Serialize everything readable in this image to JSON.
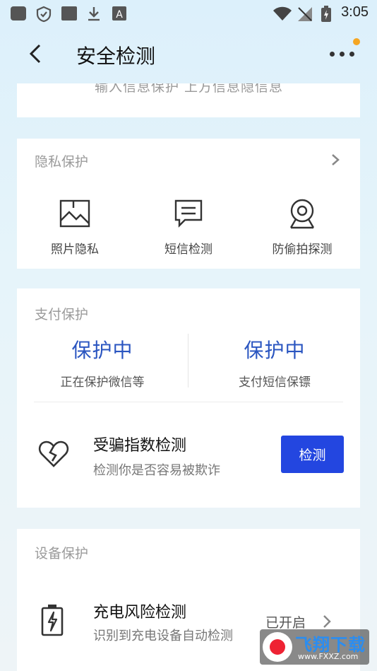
{
  "status_bar": {
    "time": "3:05",
    "icons": [
      "app-square-icon",
      "shield-icon",
      "app-square-icon",
      "download-icon",
      "a-icon",
      "wifi-icon",
      "no-signal-icon",
      "battery-charging-icon"
    ]
  },
  "header": {
    "title": "安全检测",
    "back_icon": "chevron-left-icon",
    "more_icon": "more-horizontal-icon"
  },
  "top_card": {
    "clipped_text": "输入信息保护  上方信息隐信息"
  },
  "privacy": {
    "title": "隐私保护",
    "items": [
      {
        "label": "照片隐私",
        "icon": "photo-icon"
      },
      {
        "label": "短信检测",
        "icon": "message-icon"
      },
      {
        "label": "防偷拍探测",
        "icon": "camera-icon"
      }
    ]
  },
  "payment": {
    "title": "支付保护",
    "columns": [
      {
        "status": "保护中",
        "sub": "正在保护微信等"
      },
      {
        "status": "保护中",
        "sub": "支付短信保镖"
      }
    ],
    "fraud": {
      "title": "受骗指数检测",
      "sub": "检测你是否容易被欺诈",
      "button": "检测",
      "icon": "broken-heart-icon"
    }
  },
  "device": {
    "title": "设备保护",
    "charge": {
      "title": "充电风险检测",
      "sub": "识别到充电设备自动检测",
      "status": "已开启",
      "icon": "battery-charge-icon"
    }
  },
  "watermark": {
    "text": "飞翔下载",
    "url": "www.FXXZ.com"
  },
  "colors": {
    "accent": "#2346e0",
    "status_blue": "#2a55c0",
    "notify": "#f5a623"
  }
}
